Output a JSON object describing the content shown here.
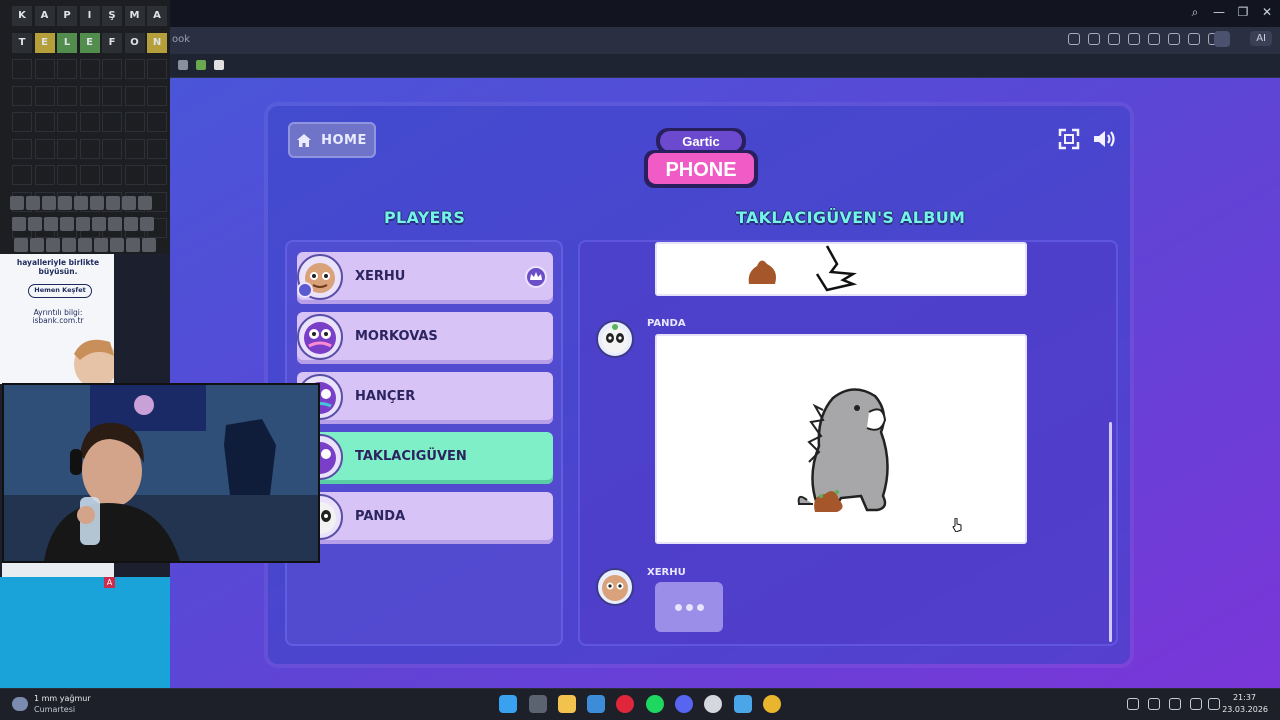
{
  "browser": {
    "tab_fragment": "ook",
    "ai_label": "AI"
  },
  "game": {
    "home_label": "HOME",
    "logo_top": "Gartic",
    "logo_bottom": "PHONE",
    "players_title": "PLAYERS",
    "album_title": "TAKLACIGÜVEN'S ALBUM",
    "players": [
      {
        "name": "XERHU",
        "host": true,
        "you": true,
        "active": false
      },
      {
        "name": "MORKOVAS",
        "host": false,
        "you": false,
        "active": false
      },
      {
        "name": "HANÇER",
        "host": false,
        "you": false,
        "active": false
      },
      {
        "name": "TAKLACIGÜVEN",
        "host": false,
        "you": false,
        "active": true
      },
      {
        "name": "PANDA",
        "host": false,
        "you": false,
        "active": false
      }
    ],
    "messages": [
      {
        "author": "PANDA",
        "type": "drawing"
      },
      {
        "author": "XERHU",
        "type": "typing"
      }
    ]
  },
  "wordgame": {
    "row1": [
      "K",
      "A",
      "P",
      "I",
      "Ş",
      "M",
      "A"
    ],
    "row2": [
      "T",
      "E",
      "L",
      "E",
      "F",
      "O",
      "N"
    ],
    "row2_colors": [
      "#2c2f34",
      "#b59f3b",
      "#538d4e",
      "#538d4e",
      "#2c2f34",
      "#2c2f34",
      "#b59f3b"
    ]
  },
  "ad": {
    "line1": "hayalleriyle birlikte",
    "line2": "büyüsün.",
    "button": "Hemen Keşfet",
    "info1": "Ayrıntılı bilgi:",
    "info2": "isbank.com.tr"
  },
  "overlay_badge": "A",
  "taskbar": {
    "weather_temp": "1 mm yağmur",
    "weather_day": "Cumartesi",
    "time": "21:37",
    "date": "23.03.2026"
  }
}
